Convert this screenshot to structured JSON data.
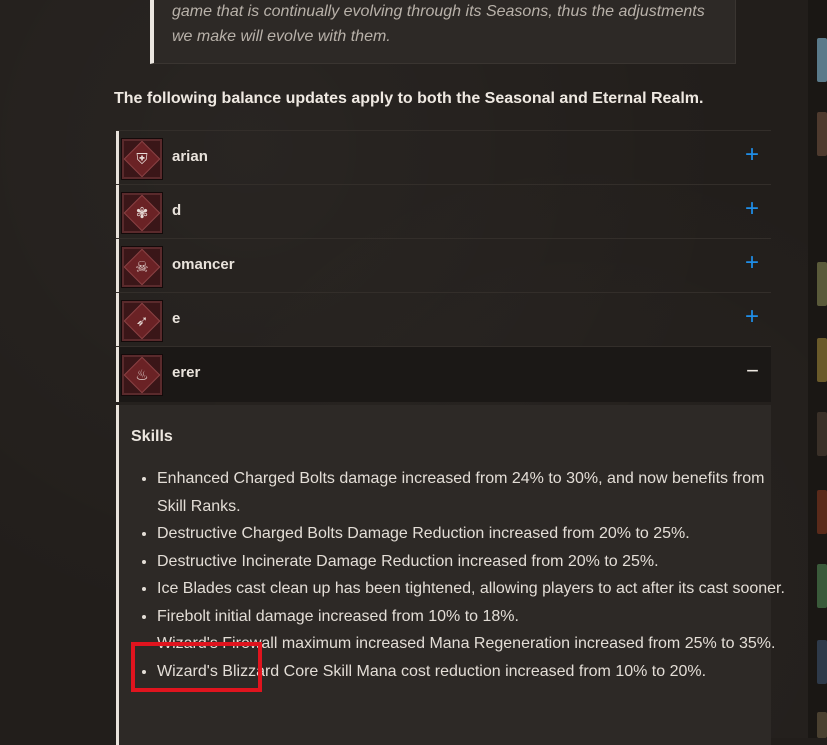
{
  "quote": {
    "line1": "game that is continually evolving through its Seasons, thus the adjustments",
    "line2": "we make will evolve with them."
  },
  "heading": "The following balance updates apply to both the Seasonal and Eternal Realm.",
  "classes": [
    {
      "label": "arian",
      "icon": "barbarian-helm-icon",
      "glyph": "⛨",
      "toggle": "+"
    },
    {
      "label": "d",
      "icon": "druid-paw-icon",
      "glyph": "✾",
      "toggle": "+"
    },
    {
      "label": "omancer",
      "icon": "necromancer-skull-icon",
      "glyph": "☠",
      "toggle": "+"
    },
    {
      "label": "e",
      "icon": "rogue-bow-icon",
      "glyph": "➶",
      "toggle": "+"
    },
    {
      "label": "erer",
      "icon": "sorcerer-flame-icon",
      "glyph": "♨",
      "toggle": "−"
    }
  ],
  "colors": {
    "accent_blue": "#1f8ee8",
    "highlight_red": "#e0141e",
    "class_icon_bg": "#3a1618"
  },
  "panel": {
    "title": "Skills",
    "notes": [
      "Enhanced Charged Bolts damage increased from 24% to 30%, and now benefits from Skill Ranks.",
      "Destructive Charged Bolts Damage Reduction increased from 20% to 25%.",
      "Destructive Incinerate Damage Reduction increased from 20% to 25%.",
      "Ice Blades cast clean up has been tightened, allowing players to act after its cast sooner.",
      "Firebolt initial damage increased from 10% to 18%.",
      "Wizard's Firewall maximum increased Mana Regeneration increased from 25% to 35%.",
      "Wizard's Blizzard Core Skill Mana cost reduction increased from 10% to 20%."
    ]
  }
}
